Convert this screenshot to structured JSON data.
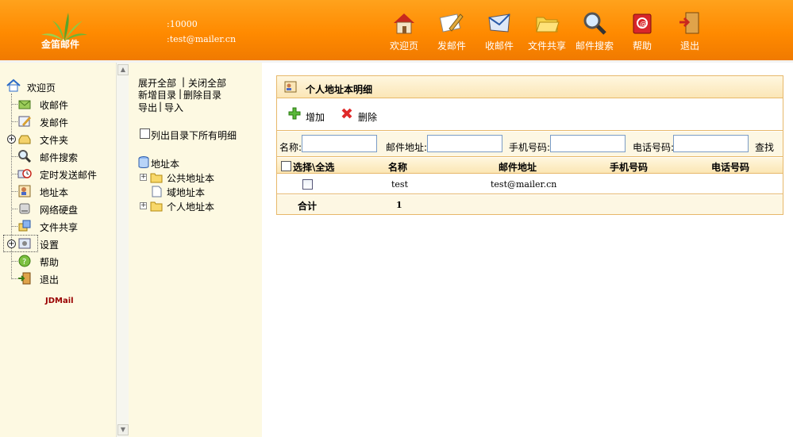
{
  "header": {
    "logo_text": "金笛邮件",
    "user_id": ":10000",
    "user_email": ":test@mailer.cn",
    "nav": [
      {
        "label": "欢迎页",
        "icon": "house-icon"
      },
      {
        "label": "发邮件",
        "icon": "compose-icon"
      },
      {
        "label": "收邮件",
        "icon": "inbox-envelope-icon"
      },
      {
        "label": "文件共享",
        "icon": "folder-share-icon"
      },
      {
        "label": "邮件搜索",
        "icon": "magnifier-icon"
      },
      {
        "label": "帮助",
        "icon": "help-book-icon"
      },
      {
        "label": "退出",
        "icon": "exit-door-icon"
      }
    ]
  },
  "sidebar": {
    "home_label": "欢迎页",
    "items": [
      {
        "label": "收邮件",
        "icon": "receive-mail-icon"
      },
      {
        "label": "发邮件",
        "icon": "send-mail-icon"
      },
      {
        "label": "文件夹",
        "icon": "folder-tray-icon"
      },
      {
        "label": "邮件搜索",
        "icon": "search-icon"
      },
      {
        "label": "定时发送邮件",
        "icon": "clock-mail-icon"
      },
      {
        "label": "地址本",
        "icon": "address-book-icon"
      },
      {
        "label": "网络硬盘",
        "icon": "disk-icon"
      },
      {
        "label": "文件共享",
        "icon": "share-icon"
      },
      {
        "label": "设置",
        "icon": "settings-icon"
      },
      {
        "label": "帮助",
        "icon": "help-icon"
      },
      {
        "label": "退出",
        "icon": "exit-icon"
      }
    ],
    "brand": "JDMail"
  },
  "midpanel": {
    "expand_all": "展开全部",
    "sep1": "|",
    "collapse_all": "关闭全部",
    "new_dir": "新增目录",
    "sep2": "|",
    "delete_dir": "删除目录",
    "export": "导出",
    "sep3": "|",
    "import": "导入",
    "list_all_label": "列出目录下所有明细",
    "tree_root": "地址本",
    "tree_children": [
      "公共地址本",
      "域地址本",
      "个人地址本"
    ]
  },
  "panel": {
    "title": "个人地址本明细",
    "add_label": "增加",
    "delete_label": "删除",
    "search": {
      "name_label": "名称:",
      "email_label": "邮件地址:",
      "phone_label": "手机号码:",
      "tel_label": "电话号码:",
      "name_value": "",
      "email_value": "",
      "phone_value": "",
      "tel_value": "",
      "search_button": "查找"
    },
    "columns": {
      "select": "选择\\全选",
      "name": "名称",
      "email": "邮件地址",
      "mobile": "手机号码",
      "phone": "电话号码"
    },
    "rows": [
      {
        "name": "test",
        "email": "test@mailer.cn",
        "mobile": "",
        "phone": ""
      }
    ],
    "total_label": "合计",
    "total_count": "1"
  },
  "colors": {
    "header_orange": "#ff8a00",
    "sidebar_bg": "#fdf9e2",
    "panel_border": "#e7b86a",
    "brand_red": "#990000"
  }
}
